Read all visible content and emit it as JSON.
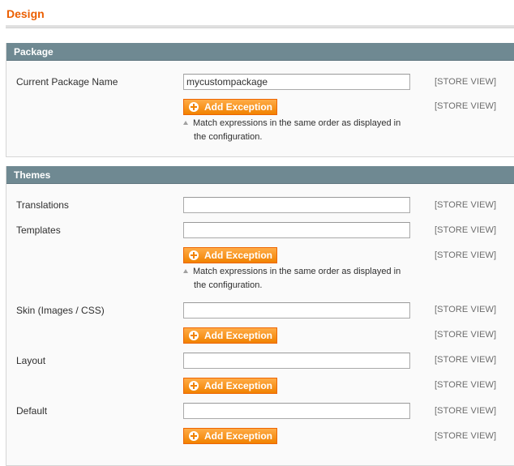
{
  "page": {
    "title": "Design"
  },
  "package": {
    "header": "Package",
    "current_package_label": "Current Package Name",
    "current_package_value": "mycustompackage",
    "scope": "[STORE VIEW]",
    "add_exception": "Add Exception",
    "note_line1": "Match expressions in the same order as displayed in",
    "note_line2": "the configuration."
  },
  "themes": {
    "header": "Themes",
    "scope": "[STORE VIEW]",
    "add_exception": "Add Exception",
    "note_line1": "Match expressions in the same order as displayed in",
    "note_line2": "the configuration.",
    "translations": {
      "label": "Translations",
      "value": ""
    },
    "templates": {
      "label": "Templates",
      "value": ""
    },
    "skin": {
      "label": "Skin (Images / CSS)",
      "value": ""
    },
    "layout": {
      "label": "Layout",
      "value": ""
    },
    "default": {
      "label": "Default",
      "value": ""
    }
  },
  "colors": {
    "title": "#eb5e00",
    "section_header_bg": "#6f8992",
    "button_orange": "#f18200"
  },
  "icons": {
    "add": "plus-circle-icon",
    "note": "triangle-up-icon"
  }
}
